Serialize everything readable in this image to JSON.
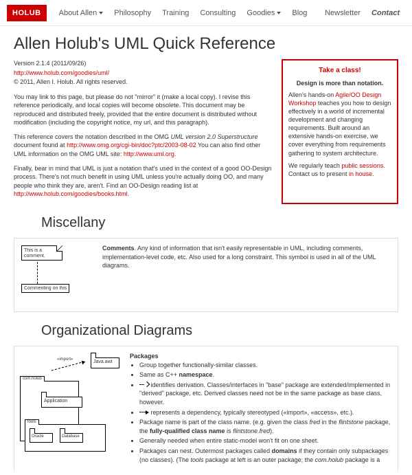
{
  "nav": {
    "brand": "HOLUB",
    "items": [
      "About Allen",
      "Philosophy",
      "Training",
      "Consulting",
      "Goodies",
      "Blog"
    ],
    "right": [
      "Newsletter",
      "Contact"
    ]
  },
  "page": {
    "title": "Allen Holub's UML Quick Reference",
    "version_line": "Version 2.1.4 (2011/09/26)",
    "url": "http://www.holub.com/goodies/uml/",
    "copyright": "© 2011, Allen I. Holub. All rights reserved.",
    "para1": "You may link to this page, but please do not \"mirror\" it (make a local copy). I revise this reference periodically, and local copies will become obsolete. This document may be reproduced and distributed freely, provided that the entire document is distributed without modification (including the copyright notice, my url, and this paragraph).",
    "para2_pre": "This reference covers the notation described in the OMG ",
    "para2_em": "UML version 2.0 Superstructure",
    "para2_mid": " document found at ",
    "para2_link1": "http://www.omg.org/cgi-bin/doc?ptc/2003-08-02",
    "para2_mid2": " You can also find other UML information on the OMG UML site: ",
    "para2_link2": "http://www.uml.org",
    "para2_end": ".",
    "para3_pre": "Finally, bear in mind that UML is just a notation that's used in the context of a good OO-Design process. There's not much benefit in using UML unless you're actually doing OO, and many people who think they are, aren't. Find an OO-Design reading list at ",
    "para3_link": "http://www.holub.com/goodies/books.html",
    "para3_end": "."
  },
  "aside": {
    "header": "Take a class!",
    "sub": "Design is more than notation.",
    "body1_pre": "Allen's hands-on ",
    "body1_link": "Agile/OO Design Workshop",
    "body1_post": " teaches you how to design effectively in a world of incremental development and changing requirements. Built around an extensive hands-on exercise, we cover everything from requirements gathering to system architecture.",
    "body2_pre": "We regularly teach ",
    "body2_link1": "public sessions",
    "body2_mid": ". Contact us to present ",
    "body2_link2": "in house",
    "body2_end": "."
  },
  "sections": {
    "misc_heading": "Miscellany",
    "org_heading": "Organizational Diagrams"
  },
  "comments": {
    "note_text": "This is a comment.",
    "box_text": "Commenting on this",
    "title": "Comments",
    "desc": ". Any kind of information that isn't easily representable in UML, including comments, implementation-level code, etc. Also used for a long constraint. This symbol is used in all of the UML diagrams."
  },
  "packages": {
    "java_awt": "Java.awt",
    "com_holub": "com.holub",
    "application": "Application",
    "tools": "tools",
    "oracle": "Oracle",
    "database": "Database",
    "import_label": "«import»",
    "title": "Packages",
    "bullets": {
      "b1": "Group together functionally-similar classes.",
      "b2_pre": "Same as C++ ",
      "b2_bold": "namespace",
      "b2_end": ".",
      "b3": " identifies derivation. Classes/interfaces in \"base\" package are extended/implemented in \"derived\" package, etc. Derived classes need not be in the same package as base class, however.",
      "b4": " represents a dependency, typically stereotyped («import», «access», etc.).",
      "b5_pre": "Package name is part of the class name. (e.g. given the class ",
      "b5_em1": "fred",
      "b5_mid1": " in the ",
      "b5_em2": "flintstone",
      "b5_mid2": " package, the ",
      "b5_bold": "fully-qualified class name",
      "b5_mid3": " is ",
      "b5_em3": "flintstone.fred",
      "b5_end": ").",
      "b6": "Generally needed when entire static-model won't fit on one sheet.",
      "b7_pre": "Packages can nest. Outermost packages called ",
      "b7_bold": "domains",
      "b7_mid": " if they contain only subpackages (no classes). (The ",
      "b7_em1": "tools",
      "b7_mid2": " package at left is an outer package; the ",
      "b7_em2": "com.holub",
      "b7_end": " package is a"
    }
  }
}
